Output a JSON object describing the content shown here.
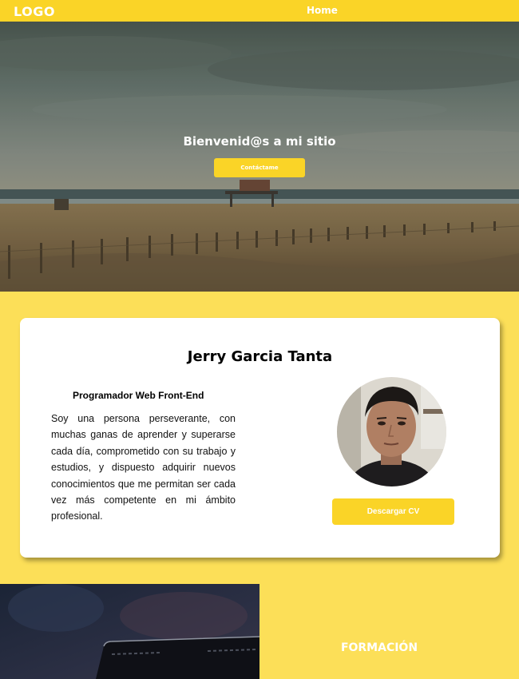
{
  "header": {
    "logo": "LOGO",
    "nav": [
      {
        "label": "Home"
      }
    ]
  },
  "hero": {
    "title": "Bienvenid@s a mi sitio",
    "button_label": "Contáctame"
  },
  "profile": {
    "name": "Jerry Garcia Tanta",
    "role": "Programador Web Front-End",
    "bio": "Soy una persona perseverante, con muchas ganas de aprender y superarse cada día, comprometido con su trabajo y estudios, y dispuesto adquirir nuevos conocimientos que me permitan ser cada vez más competente en mi ámbito profesional.",
    "download_button": "Descargar CV"
  },
  "sections": {
    "formacion_title": "FORMACIÓN"
  },
  "colors": {
    "accent": "#fad427",
    "page_background": "#fcdf58",
    "card_background": "#ffffff"
  }
}
